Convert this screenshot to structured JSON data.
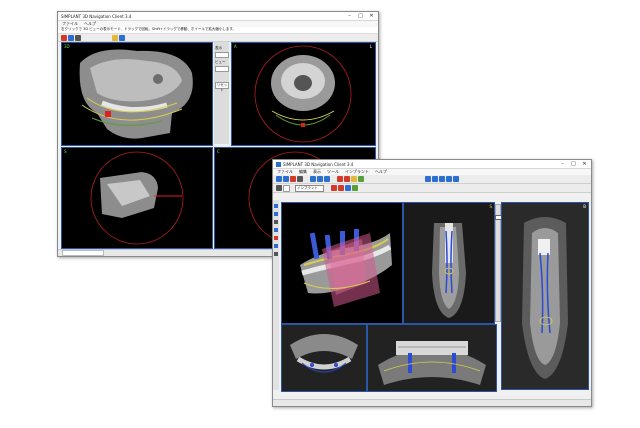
{
  "back_window": {
    "title": "SIMPLANT 3D Navigation Client 3.4",
    "menu": [
      "ファイル",
      "ヘルプ"
    ],
    "hint_text": "右クリックで 3D ビューの表示モード、ドラッグで回転、Shift+ドラッグで移動、ホイールで拡大縮小します。",
    "side_labels": [
      "表示",
      "ビュー",
      "リセット"
    ],
    "viewport_labels": [
      "3D",
      "A",
      "S",
      "C"
    ]
  },
  "front_window": {
    "title": "SIMPLANT 3D Navigation Client 3.4",
    "menu": [
      "ファイル",
      "編集",
      "表示",
      "ツール",
      "インプラント",
      "ヘルプ"
    ],
    "selector_value": "インプラント",
    "viewport_labels": [
      "3D",
      "S",
      "A",
      "C"
    ]
  },
  "icons": [
    "minimize-icon",
    "maximize-icon",
    "close-icon",
    "tooth-icon"
  ],
  "colors": {
    "accent": "#2c6fd1",
    "viewport_border": "#2a56a8",
    "label": "#7fdc5a",
    "marker": "#e02020"
  }
}
